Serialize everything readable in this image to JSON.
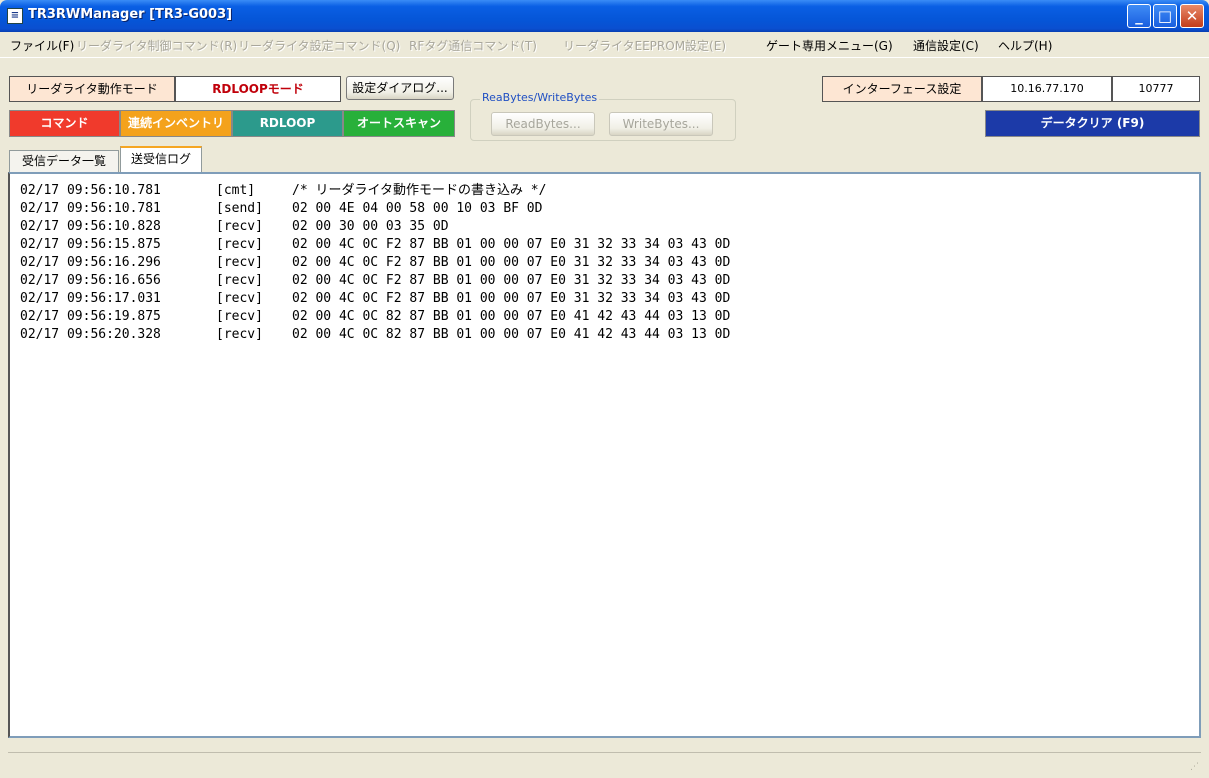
{
  "window": {
    "title": "TR3RWManager [TR3-G003]"
  },
  "menu": [
    {
      "label": "ファイル(F)",
      "enabled": true
    },
    {
      "label": "リーダライタ制御コマンド(R)",
      "enabled": false
    },
    {
      "label": "リーダライタ設定コマンド(Q)",
      "enabled": false
    },
    {
      "label": "RFタグ通信コマンド(T)",
      "enabled": false
    },
    {
      "label": "リーダライタEEPROM設定(E)",
      "enabled": false
    },
    {
      "label": "ゲート専用メニュー(G)",
      "enabled": true
    },
    {
      "label": "通信設定(C)",
      "enabled": true
    },
    {
      "label": "ヘルプ(H)",
      "enabled": true
    }
  ],
  "toolbar": {
    "mode_label": "リーダライタ動作モード",
    "mode_value": "RDLOOPモード",
    "settings_dialog": "設定ダイアログ...",
    "rw_group": "ReaBytes/WriteBytes",
    "read_bytes": "ReadBytes...",
    "write_bytes": "WriteBytes...",
    "interface_settings": "インターフェース設定",
    "ip": "10.16.77.170",
    "port": "10777",
    "cmd_command": "コマンド",
    "cmd_inventory": "連続インベントリ",
    "cmd_rdloop": "RDLOOP",
    "cmd_autoscan": "オートスキャン",
    "clear_data": "データクリア (F9)"
  },
  "colors": {
    "command": "#f03a2c",
    "inventory": "#f4a21c",
    "rdloop": "#2c9a8c",
    "autoscan": "#28b03a",
    "clear": "#1c3aa8",
    "mode_value": "#c0000a"
  },
  "tabs": [
    {
      "label": "受信データ一覧",
      "active": false
    },
    {
      "label": "送受信ログ",
      "active": true
    }
  ],
  "log": [
    {
      "time": "02/17 09:56:10.781",
      "tag": "[cmt]",
      "data": "/* リーダライタ動作モードの書き込み */"
    },
    {
      "time": "02/17 09:56:10.781",
      "tag": "[send]",
      "data": "02 00 4E 04 00 58 00 10 03 BF 0D"
    },
    {
      "time": "02/17 09:56:10.828",
      "tag": "[recv]",
      "data": "02 00 30 00 03 35 0D"
    },
    {
      "time": "02/17 09:56:15.875",
      "tag": "[recv]",
      "data": "02 00 4C 0C F2 87 BB 01 00 00 07 E0 31 32 33 34 03 43 0D"
    },
    {
      "time": "02/17 09:56:16.296",
      "tag": "[recv]",
      "data": "02 00 4C 0C F2 87 BB 01 00 00 07 E0 31 32 33 34 03 43 0D"
    },
    {
      "time": "02/17 09:56:16.656",
      "tag": "[recv]",
      "data": "02 00 4C 0C F2 87 BB 01 00 00 07 E0 31 32 33 34 03 43 0D"
    },
    {
      "time": "02/17 09:56:17.031",
      "tag": "[recv]",
      "data": "02 00 4C 0C F2 87 BB 01 00 00 07 E0 31 32 33 34 03 43 0D"
    },
    {
      "time": "02/17 09:56:19.875",
      "tag": "[recv]",
      "data": "02 00 4C 0C 82 87 BB 01 00 00 07 E0 41 42 43 44 03 13 0D"
    },
    {
      "time": "02/17 09:56:20.328",
      "tag": "[recv]",
      "data": "02 00 4C 0C 82 87 BB 01 00 00 07 E0 41 42 43 44 03 13 0D"
    }
  ]
}
